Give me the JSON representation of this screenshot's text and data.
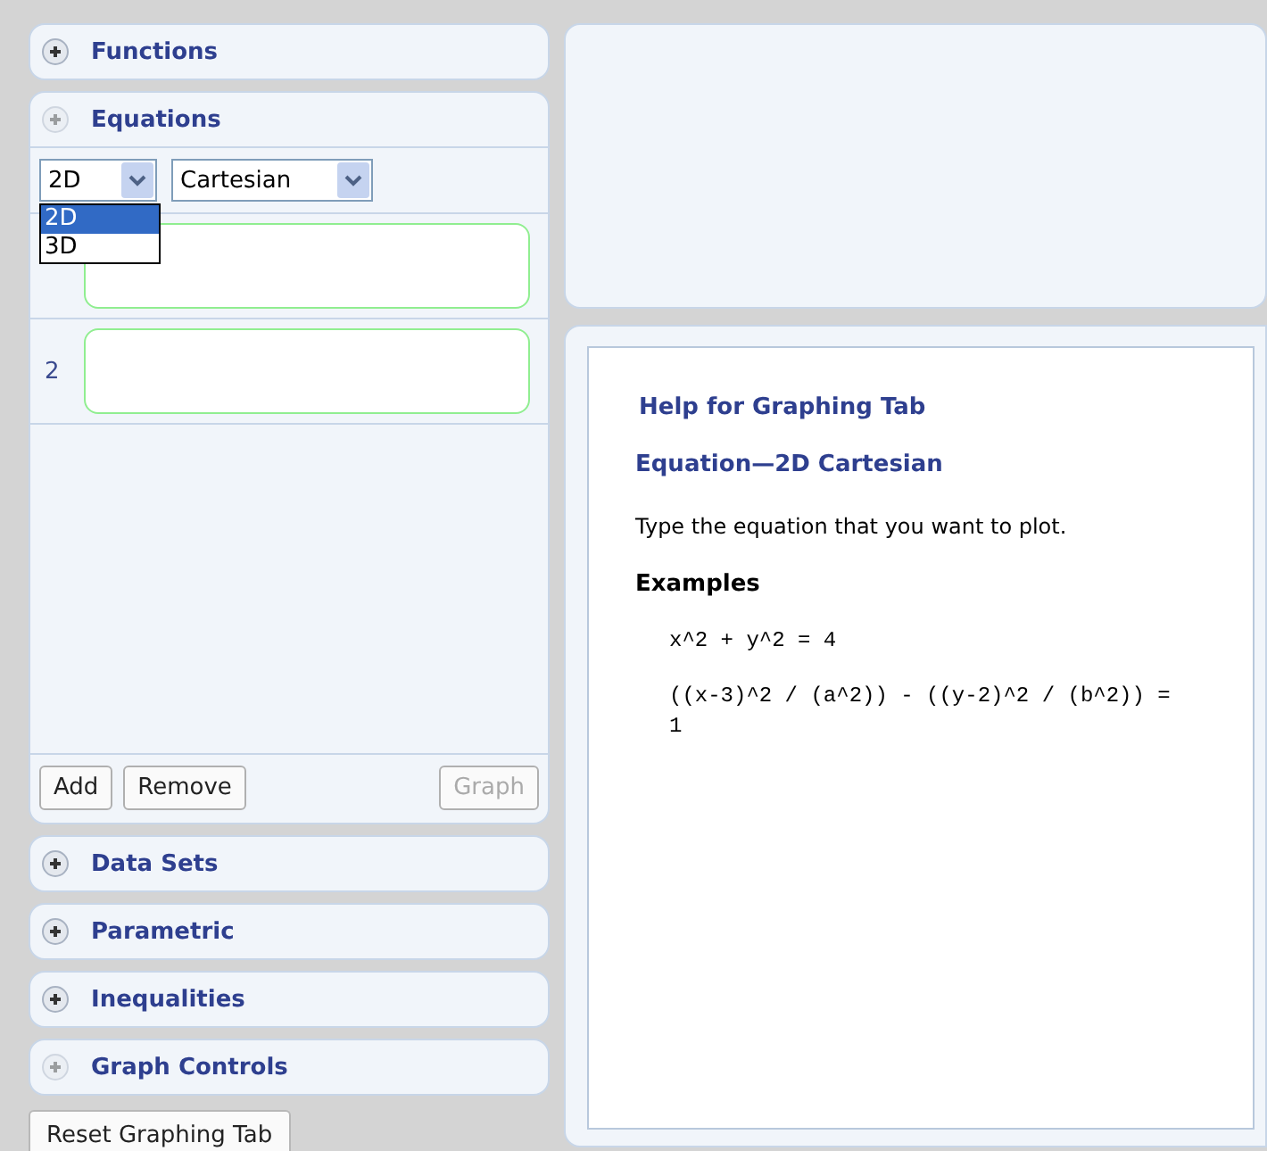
{
  "sections_before": [
    {
      "title": "Functions",
      "disabled": false
    }
  ],
  "equations": {
    "title": "Equations",
    "expanded": true,
    "dimension": {
      "value": "2D",
      "options": [
        {
          "label": "2D",
          "selected": true
        },
        {
          "label": "3D",
          "selected": false
        }
      ]
    },
    "coordinates": {
      "value": "Cartesian"
    },
    "rows": [
      {
        "kind": "covered"
      },
      {
        "kind": "numbered",
        "number": "2"
      }
    ],
    "buttons": [
      {
        "label": "Add",
        "disabled": false
      },
      {
        "label": "Remove",
        "disabled": false
      },
      {
        "label": "Graph",
        "disabled": true
      }
    ]
  },
  "sections_after": [
    {
      "title": "Data Sets",
      "disabled": false
    },
    {
      "title": "Parametric",
      "disabled": false
    },
    {
      "title": "Inequalities",
      "disabled": false
    },
    {
      "title": "Graph Controls",
      "disabled": true
    }
  ],
  "reset_button": "Reset Graphing Tab",
  "help": {
    "title": "Help for Graphing Tab",
    "subtitle": "Equation—2D Cartesian",
    "text": "Type the equation that you want to plot.",
    "examples_heading": "Examples",
    "examples": [
      "x^2 + y^2 = 4",
      "((x-3)^2 / (a^2)) - ((y-2)^2 / (b^2)) = 1"
    ]
  }
}
